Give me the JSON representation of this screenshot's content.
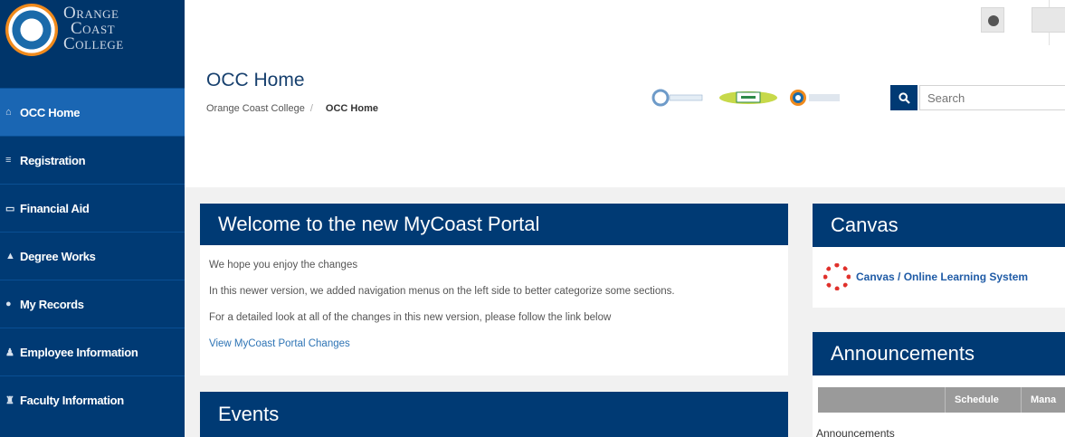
{
  "logo": {
    "line1": "Orange",
    "line2": "Coast",
    "line3": "College"
  },
  "sidebar": {
    "items": [
      {
        "icon": "home-icon",
        "glyph": "⌂",
        "label": "OCC Home"
      },
      {
        "icon": "registration-icon",
        "glyph": "≡",
        "label": "Registration"
      },
      {
        "icon": "financial-aid-icon",
        "glyph": "▭",
        "label": "Financial Aid"
      },
      {
        "icon": "degree-works-icon",
        "glyph": "▲",
        "label": "Degree Works"
      },
      {
        "icon": "records-icon",
        "glyph": "●",
        "label": "My Records"
      },
      {
        "icon": "employee-icon",
        "glyph": "♟",
        "label": "Employee Information"
      },
      {
        "icon": "faculty-icon",
        "glyph": "♜",
        "label": "Faculty Information"
      }
    ]
  },
  "header": {
    "title": "OCC Home",
    "breadcrumb": {
      "root": "Orange Coast College",
      "separator": "/",
      "current": "OCC Home"
    }
  },
  "search": {
    "placeholder": "Search"
  },
  "welcome": {
    "title": "Welcome to the new MyCoast Portal",
    "lines": [
      "We hope you enjoy the changes",
      "In this newer version, we added navigation menus on the left side to better categorize some sections.",
      "For a detailed look at all of the changes in this new version, please follow the link below"
    ],
    "link": "View MyCoast Portal Changes"
  },
  "events": {
    "title": "Events"
  },
  "canvas": {
    "title": "Canvas",
    "link": "Canvas / Online Learning System"
  },
  "announcements": {
    "title": "Announcements",
    "tabs": [
      "Schedule",
      "Mana"
    ],
    "subheading": "Announcements"
  },
  "colors": {
    "brand": "#003a74",
    "active": "#1a66b3",
    "link": "#2e74b5",
    "accent_orange": "#f08a1c"
  }
}
